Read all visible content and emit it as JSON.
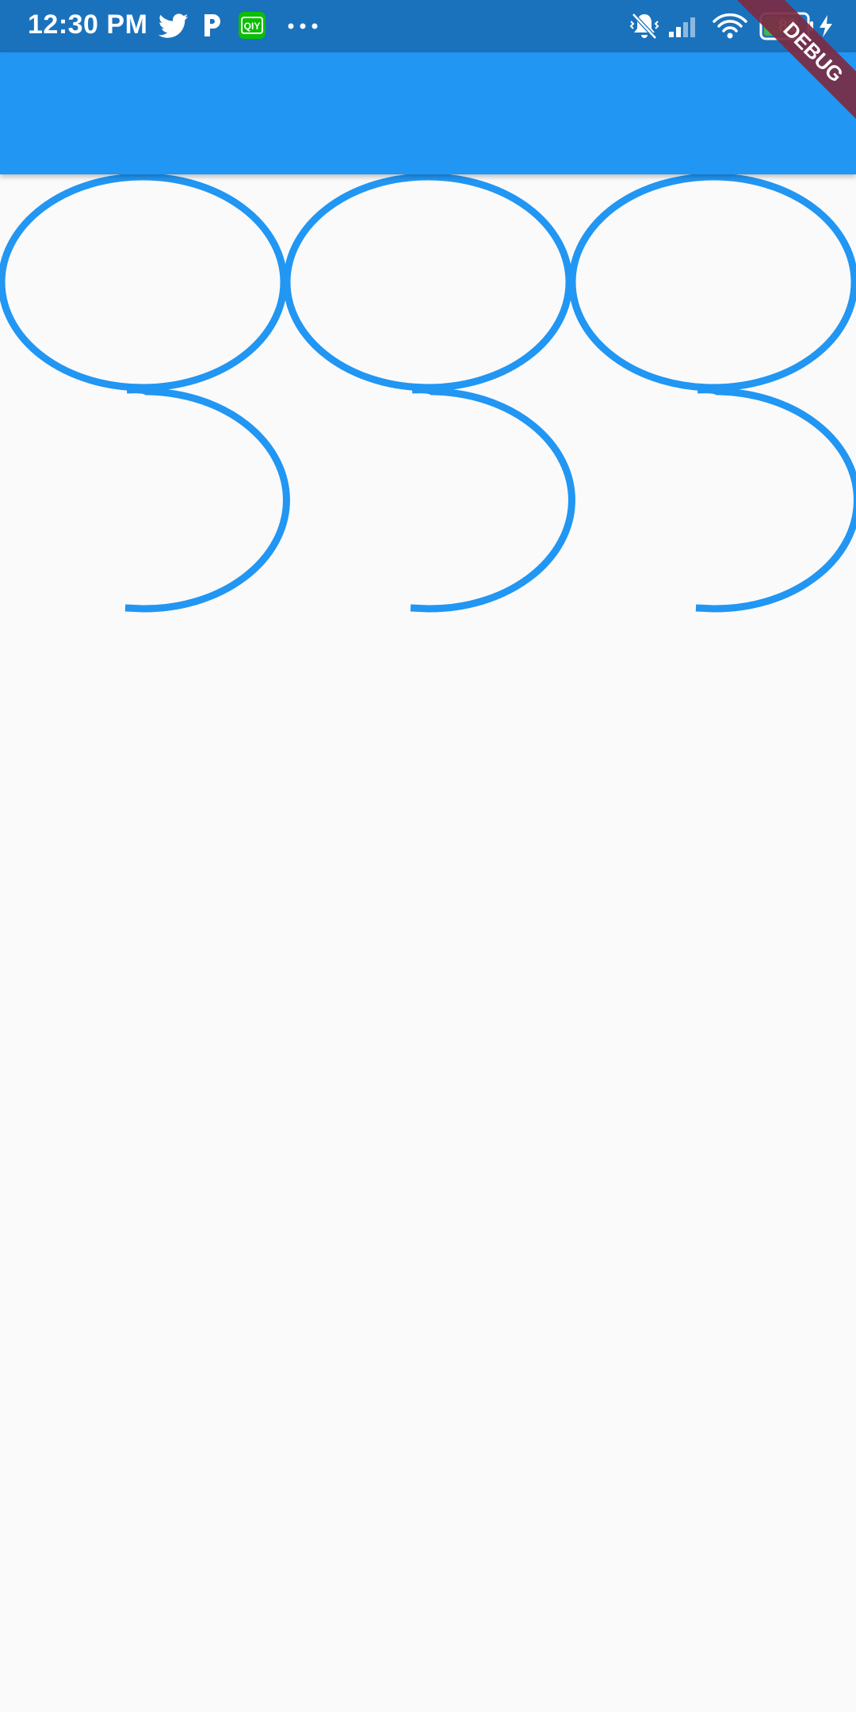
{
  "status_bar": {
    "time": "12:30 PM",
    "battery": "81",
    "background": "#1b72bc",
    "icons": [
      "twitter-icon",
      "parking-p-icon",
      "iqiyi-icon",
      "more-dots-icon",
      "vibrate-off-icon",
      "signal-icon",
      "wifi-icon",
      "battery-icon",
      "charging-icon"
    ],
    "iqiyi_label": "QIY"
  },
  "app_bar": {
    "background": "#2196f3"
  },
  "debug_banner": {
    "label": "DEBUG",
    "color": "#7b2b43"
  },
  "curves": {
    "color": "#2196f3",
    "count": 3
  }
}
